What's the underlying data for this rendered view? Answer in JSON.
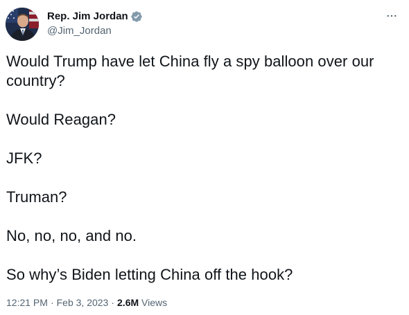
{
  "author": {
    "display_name": "Rep. Jim Jordan",
    "handle": "@Jim_Jordan",
    "verified": true,
    "verified_color": "#829aab"
  },
  "tweet": {
    "paragraphs": [
      "Would Trump have let China fly a spy balloon over our country?",
      "Would Reagan?",
      "JFK?",
      "Truman?",
      "No, no, no, and no.",
      "So why’s Biden letting China off the hook?"
    ]
  },
  "meta": {
    "time": "12:21 PM",
    "separator": "·",
    "date": "Feb 3, 2023",
    "views_count": "2.6M",
    "views_label": "Views"
  },
  "icons": {
    "more": "more-horizontal-icon",
    "verified": "verified-badge-icon"
  }
}
